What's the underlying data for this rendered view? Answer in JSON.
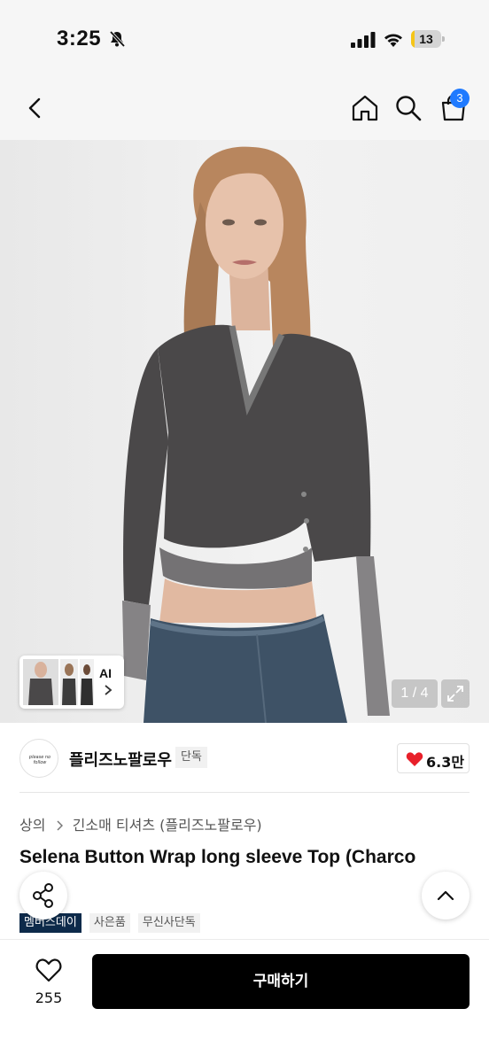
{
  "status_bar": {
    "time": "3:25",
    "battery_level": "13",
    "battery_fraction": 0.13,
    "icons": [
      "bell-off-icon",
      "cellular-signal-icon",
      "wifi-icon",
      "battery-icon"
    ]
  },
  "nav": {
    "icons": [
      "back-arrow-icon",
      "home-icon",
      "search-icon",
      "cart-icon"
    ],
    "cart_count": "3",
    "badge_color": "#1f7aff"
  },
  "gallery": {
    "ai_label": "AI",
    "page_indicator": "1 / 4",
    "current_page": 1,
    "total_pages": 4
  },
  "brand": {
    "name": "플리즈노팔로우",
    "exclusive_label": "단독",
    "like_count": "6.3만",
    "heart_color": "#e8202a"
  },
  "breadcrumb": {
    "items": [
      "상의",
      "긴소매 티셔츠 (플리즈노팔로우)"
    ]
  },
  "product": {
    "title": "Selena Button Wrap long sleeve Top (Charco"
  },
  "tags": [
    "멤버스데이",
    "사은품",
    "무신사단독"
  ],
  "bottom_bar": {
    "wish_count": "255",
    "buy_label": "구매하기"
  }
}
